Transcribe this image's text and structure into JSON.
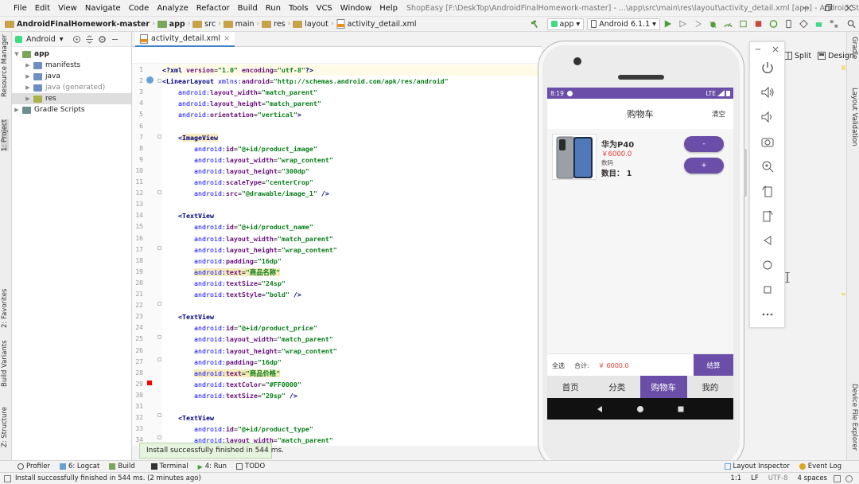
{
  "menubar": {
    "items": [
      "File",
      "Edit",
      "View",
      "Navigate",
      "Code",
      "Analyze",
      "Refactor",
      "Build",
      "Run",
      "Tools",
      "VCS",
      "Window",
      "Help"
    ],
    "window_title": "ShopEasy [F:\\DeskTop\\AndroidFinalHomework-master] - ...\\app\\src\\main\\res\\layout\\activity_detail.xml [app] - Android Studio"
  },
  "toolbar": {
    "breadcrumb": [
      "AndroidFinalHomework-master",
      "app",
      "src",
      "main",
      "res",
      "layout",
      "activity_detail.xml"
    ],
    "run_config": "app",
    "device": "Android 6.1.1"
  },
  "left_stripe": {
    "labels": [
      "Resource Manager",
      "1: Project",
      "2: Favorites",
      "Build Variants",
      "Z: Structure"
    ]
  },
  "right_stripe": {
    "labels": [
      "Gradle",
      "Layout Validation",
      "Device File Explorer"
    ]
  },
  "project_panel": {
    "view_mode": "Android",
    "tree": [
      {
        "label": "app",
        "depth": 0,
        "bold": true,
        "icon": "module-icon"
      },
      {
        "label": "manifests",
        "depth": 1,
        "icon": "folder-icon"
      },
      {
        "label": "java",
        "depth": 1,
        "icon": "folder-icon"
      },
      {
        "label": "java (generated)",
        "depth": 1,
        "icon": "folder-icon"
      },
      {
        "label": "res",
        "depth": 1,
        "icon": "res-folder-icon",
        "selected": true
      },
      {
        "label": "Gradle Scripts",
        "depth": 0,
        "icon": "gradle-icon"
      }
    ]
  },
  "editor": {
    "tab_label": "activity_detail.xml",
    "view_modes": [
      "Split",
      "Design"
    ],
    "lines": [
      {
        "n": "1",
        "tokens": [
          [
            "tag",
            "<?"
          ],
          [
            "tag",
            "xml "
          ],
          [
            "attr",
            "version"
          ],
          [
            "plain",
            "="
          ],
          [
            "val",
            "\"1.0\""
          ],
          [
            "plain",
            " "
          ],
          [
            "attr",
            "encoding"
          ],
          [
            "plain",
            "="
          ],
          [
            "val",
            "\"utf-8\""
          ],
          [
            "tag",
            "?>"
          ]
        ]
      },
      {
        "n": "2",
        "tokens": [
          [
            "tag",
            "<LinearLayout "
          ],
          [
            "ns",
            "xmlns:"
          ],
          [
            "attr",
            "android"
          ],
          [
            "plain",
            "="
          ],
          [
            "val",
            "\"http://schemas.android.com/apk/res/android\""
          ]
        ]
      },
      {
        "n": "3",
        "tokens": [
          [
            "plain",
            "    "
          ],
          [
            "ns",
            "android:"
          ],
          [
            "attr",
            "layout_width"
          ],
          [
            "plain",
            "="
          ],
          [
            "val",
            "\"match_parent\""
          ]
        ]
      },
      {
        "n": "4",
        "tokens": [
          [
            "plain",
            "    "
          ],
          [
            "ns",
            "android:"
          ],
          [
            "attr",
            "layout_height"
          ],
          [
            "plain",
            "="
          ],
          [
            "val",
            "\"match_parent\""
          ]
        ]
      },
      {
        "n": "5",
        "tokens": [
          [
            "plain",
            "    "
          ],
          [
            "ns",
            "android:"
          ],
          [
            "attr",
            "orientation"
          ],
          [
            "plain",
            "="
          ],
          [
            "val",
            "\"vertical\""
          ],
          [
            "tag",
            ">"
          ]
        ]
      },
      {
        "n": "6",
        "tokens": []
      },
      {
        "n": "7",
        "tokens": [
          [
            "plain",
            "    "
          ],
          [
            "tag",
            "<"
          ],
          [
            "tag_hl",
            "ImageView"
          ]
        ]
      },
      {
        "n": "8",
        "tokens": [
          [
            "plain",
            "        "
          ],
          [
            "ns",
            "android:"
          ],
          [
            "attr",
            "id"
          ],
          [
            "plain",
            "="
          ],
          [
            "val",
            "\"@+id/product_image\""
          ]
        ]
      },
      {
        "n": "9",
        "tokens": [
          [
            "plain",
            "        "
          ],
          [
            "ns",
            "android:"
          ],
          [
            "attr",
            "layout_width"
          ],
          [
            "plain",
            "="
          ],
          [
            "val",
            "\"wrap_content\""
          ]
        ]
      },
      {
        "n": "10",
        "tokens": [
          [
            "plain",
            "        "
          ],
          [
            "ns",
            "android:"
          ],
          [
            "attr",
            "layout_height"
          ],
          [
            "plain",
            "="
          ],
          [
            "val",
            "\"300dp\""
          ]
        ]
      },
      {
        "n": "11",
        "tokens": [
          [
            "plain",
            "        "
          ],
          [
            "ns",
            "android:"
          ],
          [
            "attr",
            "scaleType"
          ],
          [
            "plain",
            "="
          ],
          [
            "val",
            "\"centerCrop\""
          ]
        ]
      },
      {
        "n": "12",
        "tokens": [
          [
            "plain",
            "        "
          ],
          [
            "ns",
            "android:"
          ],
          [
            "attr",
            "src"
          ],
          [
            "plain",
            "="
          ],
          [
            "val",
            "\"@drawable/image_1\""
          ],
          [
            "plain",
            " "
          ],
          [
            "tag",
            "/>"
          ]
        ]
      },
      {
        "n": "13",
        "tokens": []
      },
      {
        "n": "14",
        "tokens": [
          [
            "plain",
            "    "
          ],
          [
            "tag",
            "<TextView"
          ]
        ]
      },
      {
        "n": "15",
        "tokens": [
          [
            "plain",
            "        "
          ],
          [
            "ns",
            "android:"
          ],
          [
            "attr",
            "id"
          ],
          [
            "plain",
            "="
          ],
          [
            "val",
            "\"@+id/product_name\""
          ]
        ]
      },
      {
        "n": "16",
        "tokens": [
          [
            "plain",
            "        "
          ],
          [
            "ns",
            "android:"
          ],
          [
            "attr",
            "layout_width"
          ],
          [
            "plain",
            "="
          ],
          [
            "val",
            "\"match_parent\""
          ]
        ]
      },
      {
        "n": "17",
        "tokens": [
          [
            "plain",
            "        "
          ],
          [
            "ns",
            "android:"
          ],
          [
            "attr",
            "layout_height"
          ],
          [
            "plain",
            "="
          ],
          [
            "val",
            "\"wrap_content\""
          ]
        ]
      },
      {
        "n": "18",
        "tokens": [
          [
            "plain",
            "        "
          ],
          [
            "ns",
            "android:"
          ],
          [
            "attr",
            "padding"
          ],
          [
            "plain",
            "="
          ],
          [
            "val",
            "\"16dp\""
          ]
        ]
      },
      {
        "n": "19",
        "tokens": [
          [
            "plain",
            "        "
          ],
          [
            "ns_hl",
            "android:"
          ],
          [
            "attr_hl",
            "text"
          ],
          [
            "plain_hl",
            "="
          ],
          [
            "val_hl",
            "\"商品名称\""
          ]
        ]
      },
      {
        "n": "20",
        "tokens": [
          [
            "plain",
            "        "
          ],
          [
            "ns",
            "android:"
          ],
          [
            "attr",
            "textSize"
          ],
          [
            "plain",
            "="
          ],
          [
            "val",
            "\"24sp\""
          ]
        ]
      },
      {
        "n": "21",
        "tokens": [
          [
            "plain",
            "        "
          ],
          [
            "ns",
            "android:"
          ],
          [
            "attr",
            "textStyle"
          ],
          [
            "plain",
            "="
          ],
          [
            "val",
            "\"bold\""
          ],
          [
            "plain",
            " "
          ],
          [
            "tag",
            "/>"
          ]
        ]
      },
      {
        "n": "22",
        "tokens": []
      },
      {
        "n": "23",
        "tokens": [
          [
            "plain",
            "    "
          ],
          [
            "tag",
            "<TextView"
          ]
        ]
      },
      {
        "n": "24",
        "tokens": [
          [
            "plain",
            "        "
          ],
          [
            "ns",
            "android:"
          ],
          [
            "attr",
            "id"
          ],
          [
            "plain",
            "="
          ],
          [
            "val",
            "\"@+id/product_price\""
          ]
        ]
      },
      {
        "n": "25",
        "tokens": [
          [
            "plain",
            "        "
          ],
          [
            "ns",
            "android:"
          ],
          [
            "attr",
            "layout_width"
          ],
          [
            "plain",
            "="
          ],
          [
            "val",
            "\"match_parent\""
          ]
        ]
      },
      {
        "n": "26",
        "tokens": [
          [
            "plain",
            "        "
          ],
          [
            "ns",
            "android:"
          ],
          [
            "attr",
            "layout_height"
          ],
          [
            "plain",
            "="
          ],
          [
            "val",
            "\"wrap_content\""
          ]
        ]
      },
      {
        "n": "27",
        "tokens": [
          [
            "plain",
            "        "
          ],
          [
            "ns",
            "android:"
          ],
          [
            "attr",
            "padding"
          ],
          [
            "plain",
            "="
          ],
          [
            "val",
            "\"16dp\""
          ]
        ]
      },
      {
        "n": "28",
        "tokens": [
          [
            "plain",
            "        "
          ],
          [
            "ns_hl",
            "android:"
          ],
          [
            "attr_hl",
            "text"
          ],
          [
            "plain_hl",
            "="
          ],
          [
            "val_hl",
            "\"商品价格\""
          ]
        ]
      },
      {
        "n": "29",
        "tokens": [
          [
            "plain",
            "        "
          ],
          [
            "ns",
            "android:"
          ],
          [
            "attr",
            "textColor"
          ],
          [
            "plain",
            "="
          ],
          [
            "val",
            "\"#FF0000\""
          ]
        ]
      },
      {
        "n": "30",
        "tokens": [
          [
            "plain",
            "        "
          ],
          [
            "ns",
            "android:"
          ],
          [
            "attr",
            "textSize"
          ],
          [
            "plain",
            "="
          ],
          [
            "val",
            "\"20sp\""
          ],
          [
            "plain",
            " "
          ],
          [
            "tag",
            "/>"
          ]
        ]
      },
      {
        "n": "31",
        "tokens": []
      },
      {
        "n": "32",
        "tokens": [
          [
            "plain",
            "    "
          ],
          [
            "tag",
            "<TextView"
          ]
        ]
      },
      {
        "n": "33",
        "tokens": [
          [
            "plain",
            "        "
          ],
          [
            "ns",
            "android:"
          ],
          [
            "attr",
            "id"
          ],
          [
            "plain",
            "="
          ],
          [
            "val",
            "\"@+id/product_type\""
          ]
        ]
      },
      {
        "n": "34",
        "tokens": [
          [
            "plain",
            "        "
          ],
          [
            "ns",
            "android:"
          ],
          [
            "attr",
            "layout_width"
          ],
          [
            "plain",
            "="
          ],
          [
            "val",
            "\"match_parent\""
          ]
        ]
      }
    ]
  },
  "emulator": {
    "status_time": "8:19",
    "status_net": "LTE",
    "app_title": "购物车",
    "clear_label": "清空",
    "cart_item": {
      "name": "华为P40",
      "price": "￥6000.0",
      "type_label": "数码",
      "qty_label": "数目： 1",
      "minus_label": "-",
      "plus_label": "+"
    },
    "checkout": {
      "select_all": "全选",
      "total_label": "合计:",
      "total_value": "￥ 6000.0",
      "checkout_label": "结算"
    },
    "nav_tabs": [
      {
        "label": "首页",
        "active": false
      },
      {
        "label": "分类",
        "active": false
      },
      {
        "label": "购物车",
        "active": true
      },
      {
        "label": "我的",
        "active": false
      }
    ],
    "controls": [
      "power-icon",
      "volume-up-icon",
      "volume-down-icon",
      "camera-icon",
      "zoom-icon",
      "rotate-left-icon",
      "rotate-right-icon",
      "back-icon",
      "home-icon",
      "overview-icon",
      "more-icon"
    ]
  },
  "bottom_tools": {
    "left": [
      "Profiler",
      "6: Logcat",
      "Build",
      "Terminal",
      "4: Run",
      "TODO"
    ],
    "right": [
      "Layout Inspector",
      "Event Log"
    ]
  },
  "toast": "Install successfully finished in 544 ms.",
  "status_bar": {
    "message": "Install successfully finished in 544 ms. (2 minutes ago)",
    "position": "1:1",
    "line_sep": "LF",
    "encoding": "UTF-8",
    "indent": "4 spaces"
  },
  "colors": {
    "accent": "#6a4ea8",
    "price_red": "#e53935",
    "xml_tag": "#000080",
    "xml_attr": "#660e7a",
    "xml_value": "#067d17"
  }
}
